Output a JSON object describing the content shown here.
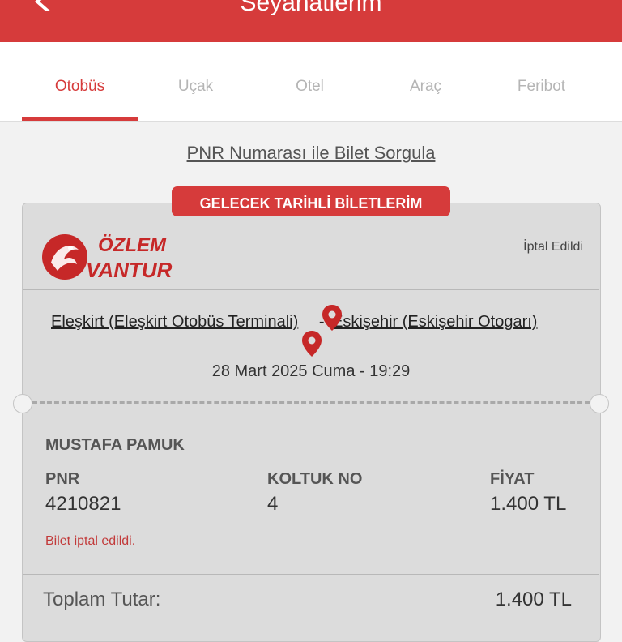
{
  "header": {
    "title": "Seyahatlerim"
  },
  "tabs": [
    {
      "label": "Otobüs",
      "active": true
    },
    {
      "label": "Uçak",
      "active": false
    },
    {
      "label": "Otel",
      "active": false
    },
    {
      "label": "Araç",
      "active": false
    },
    {
      "label": "Feribot",
      "active": false
    }
  ],
  "pnr_query_link": "PNR Numarası ile Bilet Sorgula",
  "section_badge": "GELECEK TARİHLİ BİLETLERİM",
  "ticket": {
    "company": {
      "line1": "ÖZLEM",
      "line2": "VANTUR"
    },
    "status": "İptal Edildi",
    "origin": "Eleşkirt (Eleşkirt Otobüs Terminali)",
    "separator": "-",
    "destination": "Eskişehir (Eskişehir Otogarı)",
    "datetime": "28 Mart 2025 Cuma - 19:29",
    "passenger": "MUSTAFA PAMUK",
    "pnr_label": "PNR",
    "pnr_value": "4210821",
    "seat_label": "KOLTUK NO",
    "seat_value": "4",
    "price_label": "FİYAT",
    "price_value": "1.400 TL",
    "cancel_note": "Bilet iptal edildi.",
    "total_label": "Toplam Tutar:",
    "total_value": "1.400 TL"
  },
  "colors": {
    "brand_red": "#d63b3b",
    "card_bg": "#dcdcdc",
    "page_bg": "#f2f2f2"
  },
  "icons": [
    "back-arrow-icon",
    "location-pin-icon"
  ]
}
